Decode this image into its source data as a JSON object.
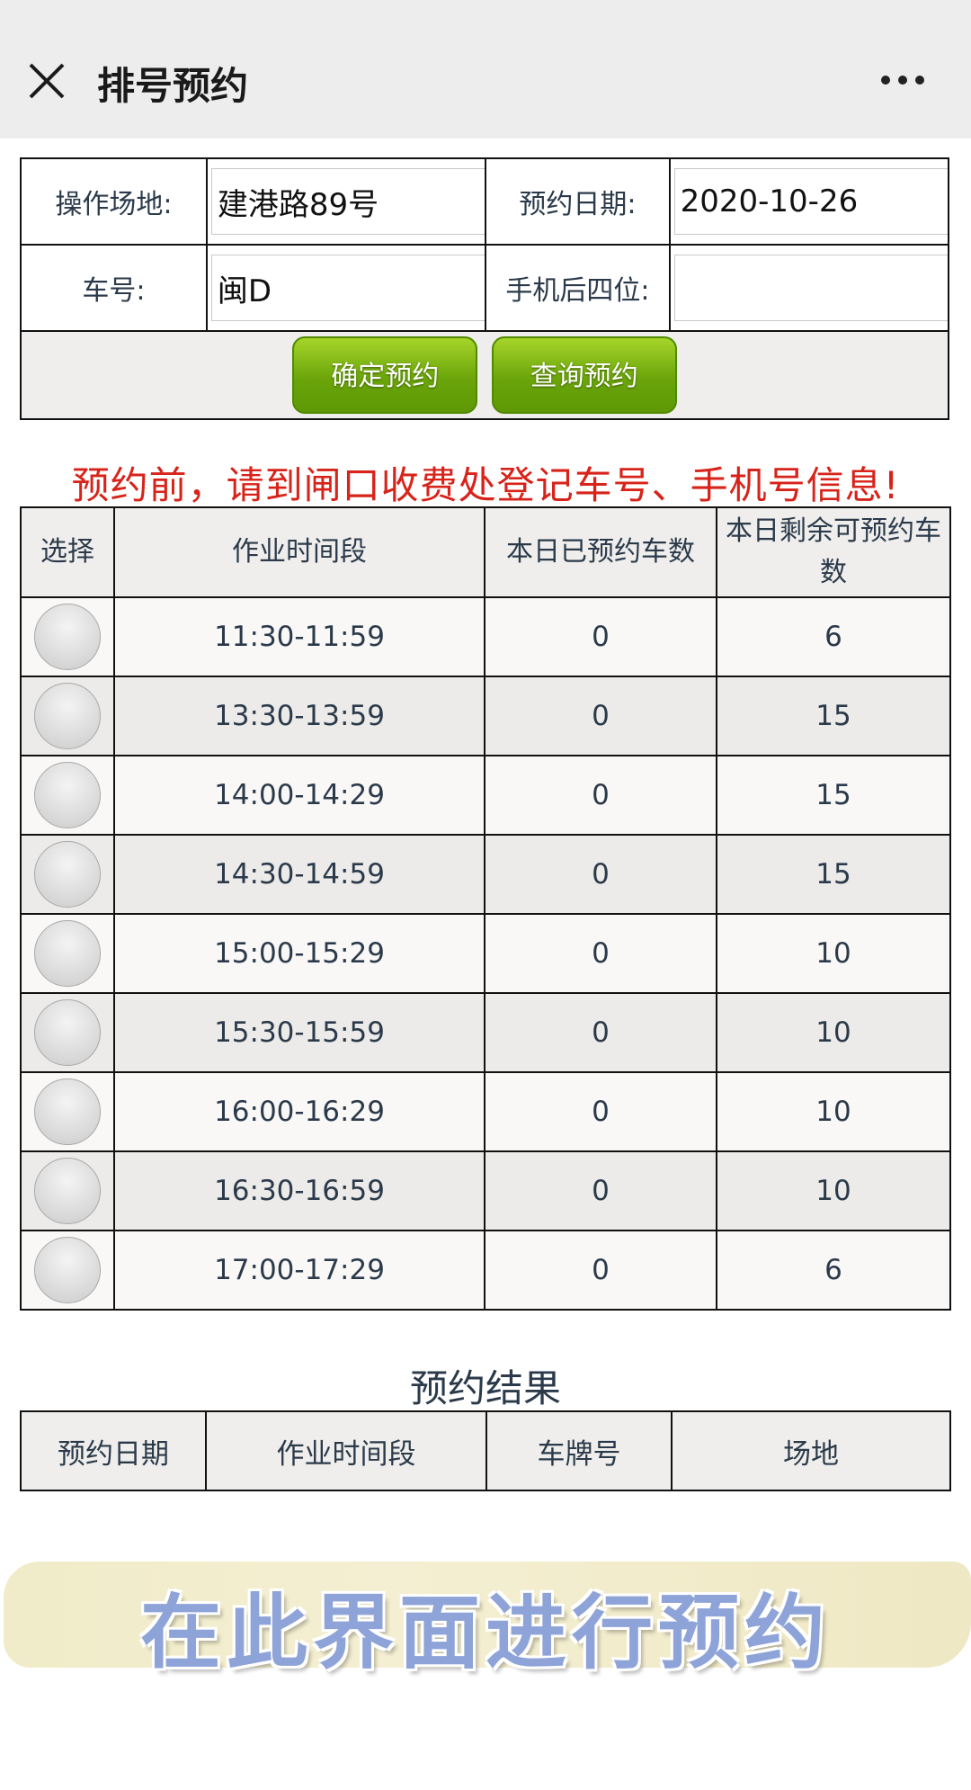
{
  "header": {
    "title": "排号预约",
    "close_icon": "close-icon",
    "more_icon": "more-icon"
  },
  "form": {
    "site_label": "操作场地:",
    "site_value": "建港路89号",
    "date_label": "预约日期:",
    "date_value": "2020-10-26",
    "plate_label": "车号:",
    "plate_value": "闽D",
    "phone_label": "手机后四位:",
    "phone_value": "",
    "confirm_button": "确定预约",
    "query_button": "查询预约"
  },
  "notice": "预约前，请到闸口收费处登记车号、手机号信息!",
  "slots": {
    "headers": [
      "选择",
      "作业时间段",
      "本日已预约车数",
      "本日剩余可预约车数"
    ],
    "rows": [
      {
        "time": "11:30-11:59",
        "booked": "0",
        "remaining": "6"
      },
      {
        "time": "13:30-13:59",
        "booked": "0",
        "remaining": "15"
      },
      {
        "time": "14:00-14:29",
        "booked": "0",
        "remaining": "15"
      },
      {
        "time": "14:30-14:59",
        "booked": "0",
        "remaining": "15"
      },
      {
        "time": "15:00-15:29",
        "booked": "0",
        "remaining": "10"
      },
      {
        "time": "15:30-15:59",
        "booked": "0",
        "remaining": "10"
      },
      {
        "time": "16:00-16:29",
        "booked": "0",
        "remaining": "10"
      },
      {
        "time": "16:30-16:59",
        "booked": "0",
        "remaining": "10"
      },
      {
        "time": "17:00-17:29",
        "booked": "0",
        "remaining": "6"
      }
    ]
  },
  "result": {
    "title": "预约结果",
    "headers": [
      "预约日期",
      "作业时间段",
      "车牌号",
      "场地"
    ]
  },
  "banner": {
    "text": "在此界面进行预约"
  },
  "colors": {
    "notice": "#d8231a",
    "button_green": "#7fb515",
    "banner_text": "#8ea3d8"
  }
}
